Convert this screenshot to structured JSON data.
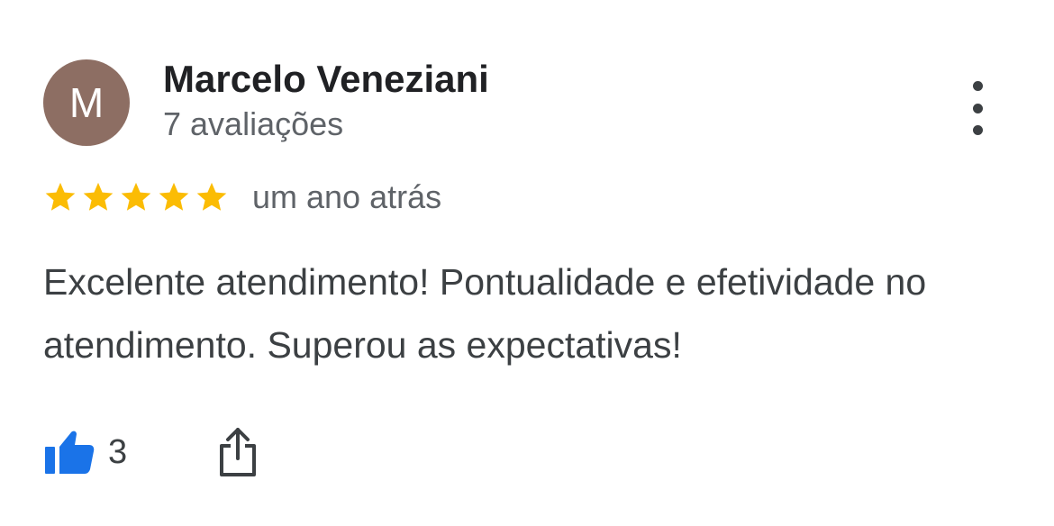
{
  "reviewer": {
    "initial": "M",
    "name": "Marcelo Veneziani",
    "review_count": "7 avaliações",
    "avatar_color": "#8d6e63"
  },
  "menu": {
    "icon": "more-vert-icon"
  },
  "rating": {
    "stars": 5,
    "max_stars": 5,
    "star_color": "#fbbc04",
    "time_ago": "um ano atrás"
  },
  "review": {
    "text": "Excelente atendimento! Pontualidade e efetividade no atendimento. Superou as expectativas!"
  },
  "actions": {
    "like_icon": "thumbs-up-icon",
    "like_color": "#1a73e8",
    "like_count": "3",
    "share_icon": "share-icon"
  }
}
